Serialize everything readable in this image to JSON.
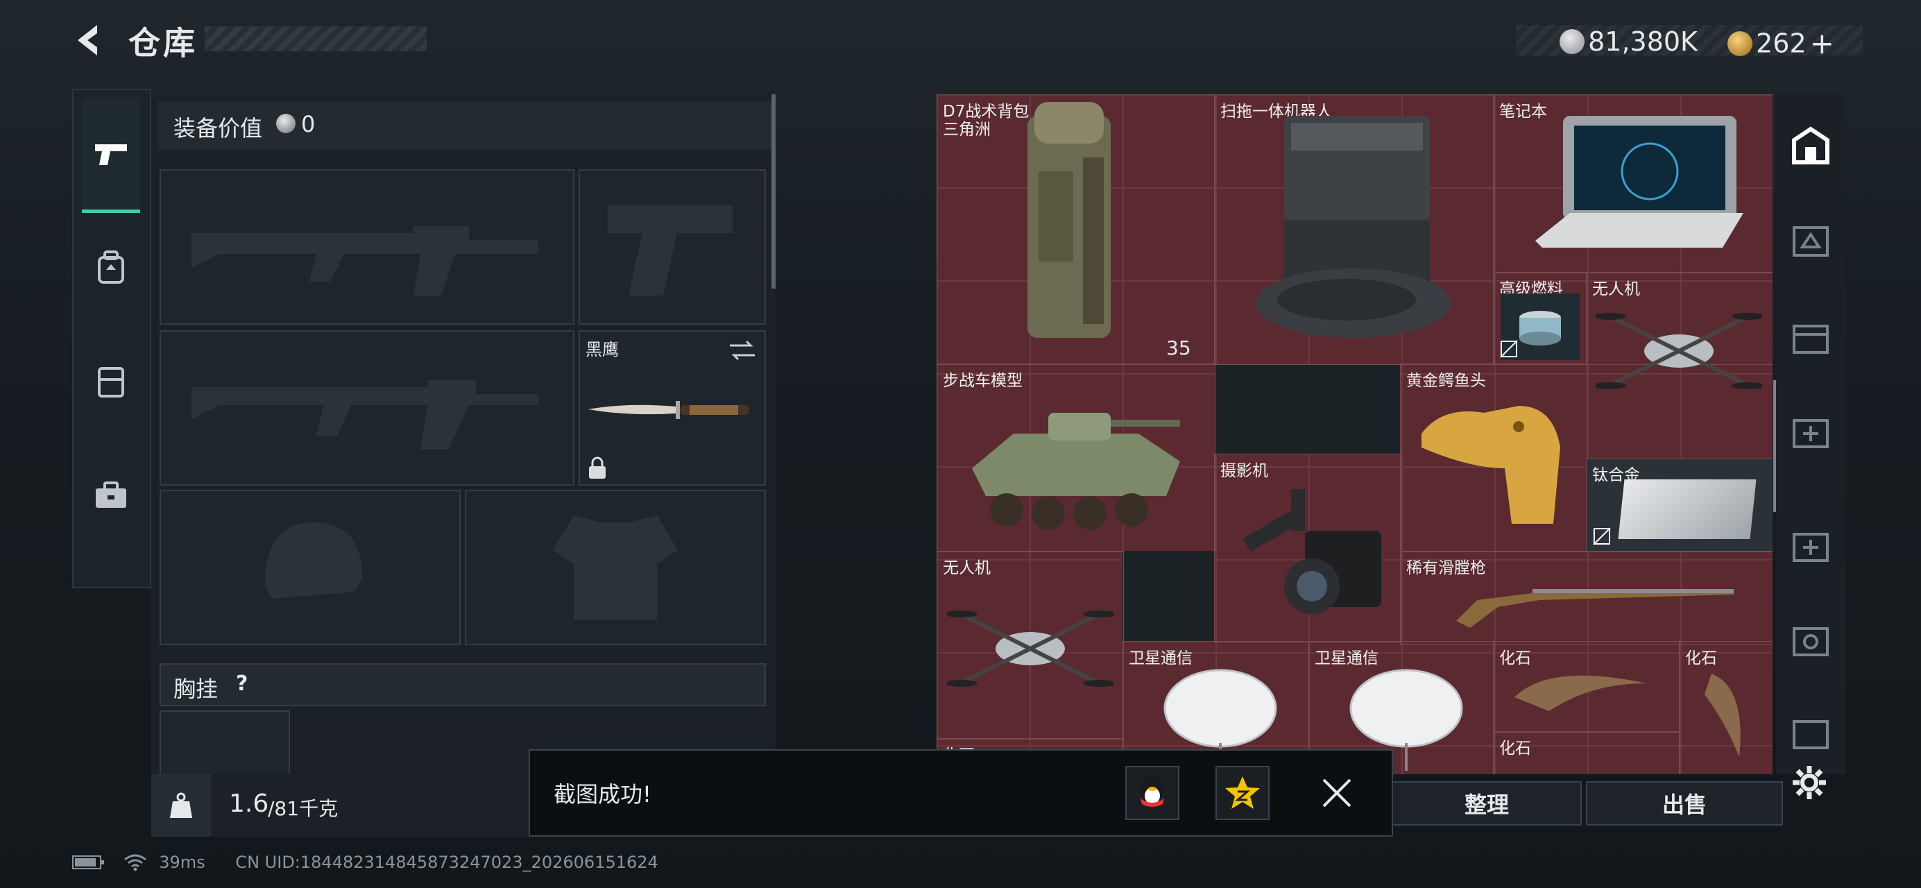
{
  "header": {
    "title": "仓库",
    "currency_silver": "81,380K",
    "currency_gold": "262"
  },
  "equipment": {
    "value_label": "装备价值",
    "value": "0",
    "knife_label": "黑鹰",
    "chest_label": "胸挂",
    "chest_help": "?"
  },
  "inventory": {
    "items": [
      {
        "label": "D7战术背包",
        "sub": "三角洲",
        "count": "35"
      },
      {
        "label": "扫拖一体机器人"
      },
      {
        "label": "笔记本"
      },
      {
        "label": "高级燃料"
      },
      {
        "label": "无人机"
      },
      {
        "label": "步战车模型"
      },
      {
        "label": "黄金鳄鱼头"
      },
      {
        "label": "摄影机"
      },
      {
        "label": "钛合金"
      },
      {
        "label": "无人机"
      },
      {
        "label": "稀有滑膛枪"
      },
      {
        "label": "卫星通信"
      },
      {
        "label": "卫星通信"
      },
      {
        "label": "化石"
      },
      {
        "label": "化石"
      },
      {
        "label": "化石"
      },
      {
        "label": "化石"
      }
    ]
  },
  "bottom": {
    "weight_current": "1.6",
    "weight_max": "/81千克",
    "sort_button": "整理",
    "sell_button": "出售"
  },
  "toast": {
    "message": "截图成功!"
  },
  "status": {
    "ping": "39ms",
    "uid": "CN UID:18448231484587324702​3_202606151624"
  },
  "colors": {
    "accent": "#3fd1a6",
    "inventory_bg": "#5a2a30",
    "gold": "#d8a640"
  }
}
